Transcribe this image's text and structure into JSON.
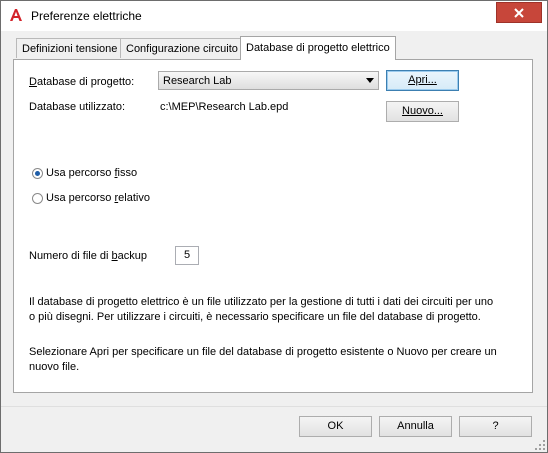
{
  "window": {
    "title": "Preferenze elettriche",
    "icon": "autocad-a-icon"
  },
  "tabs": [
    {
      "label": "Definizioni tensione",
      "active": false
    },
    {
      "label": "Configurazione circuito",
      "active": false
    },
    {
      "label": "Database di progetto elettrico",
      "active": true
    }
  ],
  "database": {
    "label_prefix": "D",
    "label_rest": "atabase di progetto:",
    "selected": "Research Lab",
    "open_button": "Apri...",
    "in_use_label": "Database utilizzato:",
    "in_use_path": "c:\\MEP\\Research Lab.epd",
    "new_button": "Nuovo..."
  },
  "path_options": {
    "fixed_pre": "Usa percorso ",
    "fixed_key": "f",
    "fixed_post": "isso",
    "fixed_selected": true,
    "relative_pre": "Usa percorso ",
    "relative_key": "r",
    "relative_post": "elativo",
    "relative_selected": false
  },
  "backup": {
    "label_pre": "Numero di file di ",
    "label_key": "b",
    "label_post": "ackup",
    "value": "5"
  },
  "description": {
    "para1": "Il database di progetto elettrico è un file utilizzato per la gestione di tutti i dati dei circuiti per uno o più disegni. Per utilizzare i circuiti, è necessario specificare un file del database di progetto.",
    "para2": "Selezionare Apri per specificare un file del database di progetto esistente o Nuovo per creare un nuovo file."
  },
  "footer": {
    "ok": "OK",
    "cancel": "Annulla",
    "help": "?"
  },
  "colors": {
    "close_button": "#c7463a",
    "app_icon": "#d3232a",
    "radio_dot": "#1f5ea8"
  }
}
